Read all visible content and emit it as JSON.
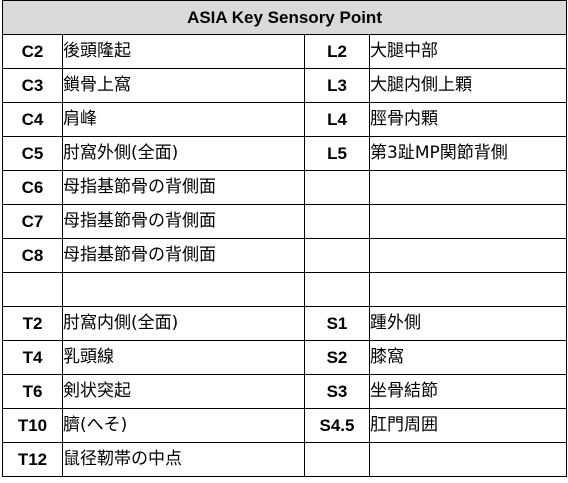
{
  "header_color": "#d9d9d9",
  "table": {
    "title": "ASIA Key Sensory Point",
    "rows": [
      {
        "l_code": "C2",
        "l_name": "後頭隆起",
        "r_code": "L2",
        "r_name": "大腿中部"
      },
      {
        "l_code": "C3",
        "l_name": "鎖骨上窩",
        "r_code": "L3",
        "r_name": "大腿内側上顆"
      },
      {
        "l_code": "C4",
        "l_name": "肩峰",
        "r_code": "L4",
        "r_name": "脛骨内顆"
      },
      {
        "l_code": "C5",
        "l_name": "肘窩外側(全面)",
        "r_code": "L5",
        "r_name": "第3趾MP関節背側"
      },
      {
        "l_code": "C6",
        "l_name": "母指基節骨の背側面",
        "r_code": "",
        "r_name": ""
      },
      {
        "l_code": "C7",
        "l_name": "母指基節骨の背側面",
        "r_code": "",
        "r_name": ""
      },
      {
        "l_code": "C8",
        "l_name": "母指基節骨の背側面",
        "r_code": "",
        "r_name": ""
      },
      {
        "l_code": "",
        "l_name": "",
        "r_code": "",
        "r_name": ""
      },
      {
        "l_code": "T2",
        "l_name": "肘窩内側(全面)",
        "r_code": "S1",
        "r_name": "踵外側"
      },
      {
        "l_code": "T4",
        "l_name": "乳頭線",
        "r_code": "S2",
        "r_name": "膝窩"
      },
      {
        "l_code": "T6",
        "l_name": "剣状突起",
        "r_code": "S3",
        "r_name": "坐骨結節"
      },
      {
        "l_code": "T10",
        "l_name": "臍(へそ)",
        "r_code": "S4.5",
        "r_name": "肛門周囲"
      },
      {
        "l_code": "T12",
        "l_name": "鼠径靭帯の中点",
        "r_code": "",
        "r_name": ""
      }
    ]
  }
}
